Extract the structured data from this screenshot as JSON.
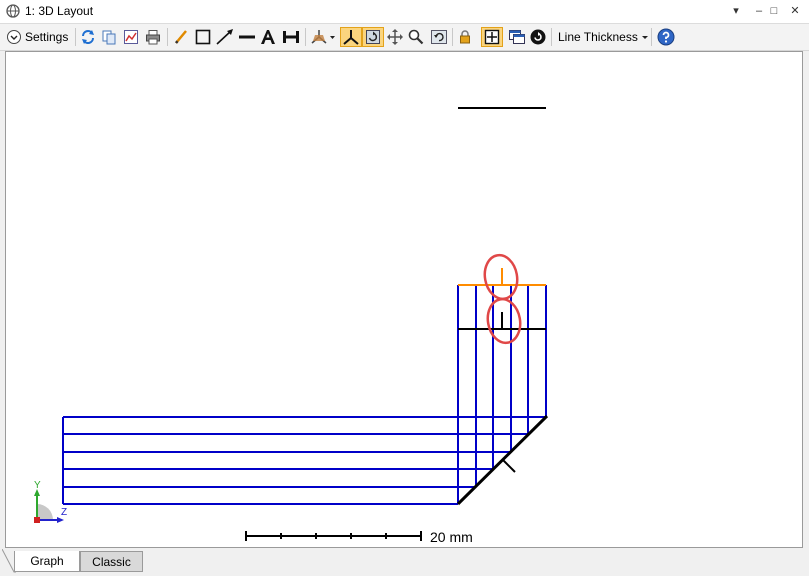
{
  "window": {
    "title": "1: 3D Layout",
    "controls": [
      "▾",
      "–",
      "□",
      "✕"
    ]
  },
  "toolbar": {
    "settings_label": "Settings",
    "line_thickness_label": "Line Thickness",
    "icons": [
      "settings-chevron-icon",
      "refresh-icon",
      "copy-icon",
      "export-icon",
      "print-icon",
      "pencil-icon",
      "rectangle-icon",
      "arrow-icon",
      "line-icon",
      "text-icon",
      "dimension-icon",
      "rotate-dropdown-icon",
      "axes-icon",
      "rotate-view-icon",
      "pan-icon",
      "zoom-icon",
      "reset-view-icon",
      "lock-icon",
      "fit-icon",
      "windows-icon",
      "cycle-icon",
      "help-icon"
    ]
  },
  "canvas": {
    "scale_bar_label": "20 mm",
    "axis_labels": {
      "y": "Y",
      "z": "Z"
    },
    "colors": {
      "rays": "#0000c8",
      "lens": "#000000",
      "detector": "#ff8c00",
      "annotation": "#e04848",
      "axis_y": "#2ea82e",
      "axis_z": "#2222cc",
      "axis_x": "#d02020"
    }
  },
  "tabs": [
    {
      "label": "Graph",
      "active": true
    },
    {
      "label": "Classic",
      "active": false
    }
  ]
}
